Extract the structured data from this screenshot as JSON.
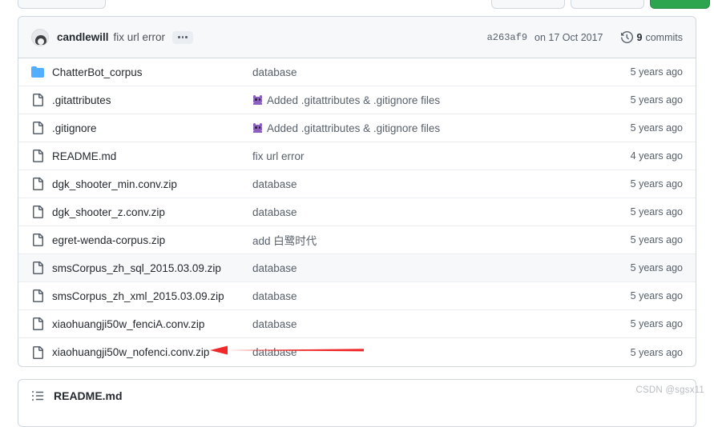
{
  "toolbar": {
    "buttons": [
      {
        "name": "branch-button",
        "style": "gray"
      },
      {
        "name": "go-to-file-button",
        "style": "gray"
      },
      {
        "name": "add-file-button",
        "style": "gray"
      },
      {
        "name": "code-button",
        "style": "green"
      }
    ],
    "green_color": "#2da44e"
  },
  "commit_header": {
    "author": "candlewill",
    "message": "fix url error",
    "ellipsis_label": "...",
    "sha": "a263af9",
    "date": "on 17 Oct 2017",
    "commits_count": "9",
    "commits_label": "commits",
    "history_icon": "history-icon",
    "avatar_icon": "avatar"
  },
  "files": [
    {
      "icon": "folder-icon",
      "type": "folder",
      "name": "ChatterBot_corpus",
      "message": "database",
      "emoji": "",
      "age": "5 years ago",
      "hovered": false
    },
    {
      "icon": "file-icon",
      "type": "file",
      "name": ".gitattributes",
      "message": "Added .gitattributes & .gitignore files",
      "emoji": "invader-emoji",
      "age": "5 years ago",
      "hovered": false
    },
    {
      "icon": "file-icon",
      "type": "file",
      "name": ".gitignore",
      "message": "Added .gitattributes & .gitignore files",
      "emoji": "invader-emoji",
      "age": "5 years ago",
      "hovered": false
    },
    {
      "icon": "file-icon",
      "type": "file",
      "name": "README.md",
      "message": "fix url error",
      "emoji": "",
      "age": "4 years ago",
      "hovered": false
    },
    {
      "icon": "file-icon",
      "type": "file",
      "name": "dgk_shooter_min.conv.zip",
      "message": "database",
      "emoji": "",
      "age": "5 years ago",
      "hovered": false
    },
    {
      "icon": "file-icon",
      "type": "file",
      "name": "dgk_shooter_z.conv.zip",
      "message": "database",
      "emoji": "",
      "age": "5 years ago",
      "hovered": false
    },
    {
      "icon": "file-icon",
      "type": "file",
      "name": "egret-wenda-corpus.zip",
      "message": "add 白鹭时代",
      "emoji": "",
      "age": "5 years ago",
      "hovered": false
    },
    {
      "icon": "file-icon",
      "type": "file",
      "name": "smsCorpus_zh_sql_2015.03.09.zip",
      "message": "database",
      "emoji": "",
      "age": "5 years ago",
      "hovered": true
    },
    {
      "icon": "file-icon",
      "type": "file",
      "name": "smsCorpus_zh_xml_2015.03.09.zip",
      "message": "database",
      "emoji": "",
      "age": "5 years ago",
      "hovered": false
    },
    {
      "icon": "file-icon",
      "type": "file",
      "name": "xiaohuangji50w_fenciA.conv.zip",
      "message": "database",
      "emoji": "",
      "age": "5 years ago",
      "hovered": false
    },
    {
      "icon": "file-icon",
      "type": "file",
      "name": "xiaohuangji50w_nofenci.conv.zip",
      "message": "database",
      "emoji": "",
      "age": "5 years ago",
      "hovered": false
    }
  ],
  "annotation": {
    "name": "red-arrow-annotation",
    "color": "#ef2929",
    "points_to": "xiaohuangji50w_nofenci.conv.zip"
  },
  "readme_section": {
    "icon": "list-unordered-icon",
    "title": "README.md"
  },
  "watermark": {
    "text": "CSDN @sgsx11"
  }
}
